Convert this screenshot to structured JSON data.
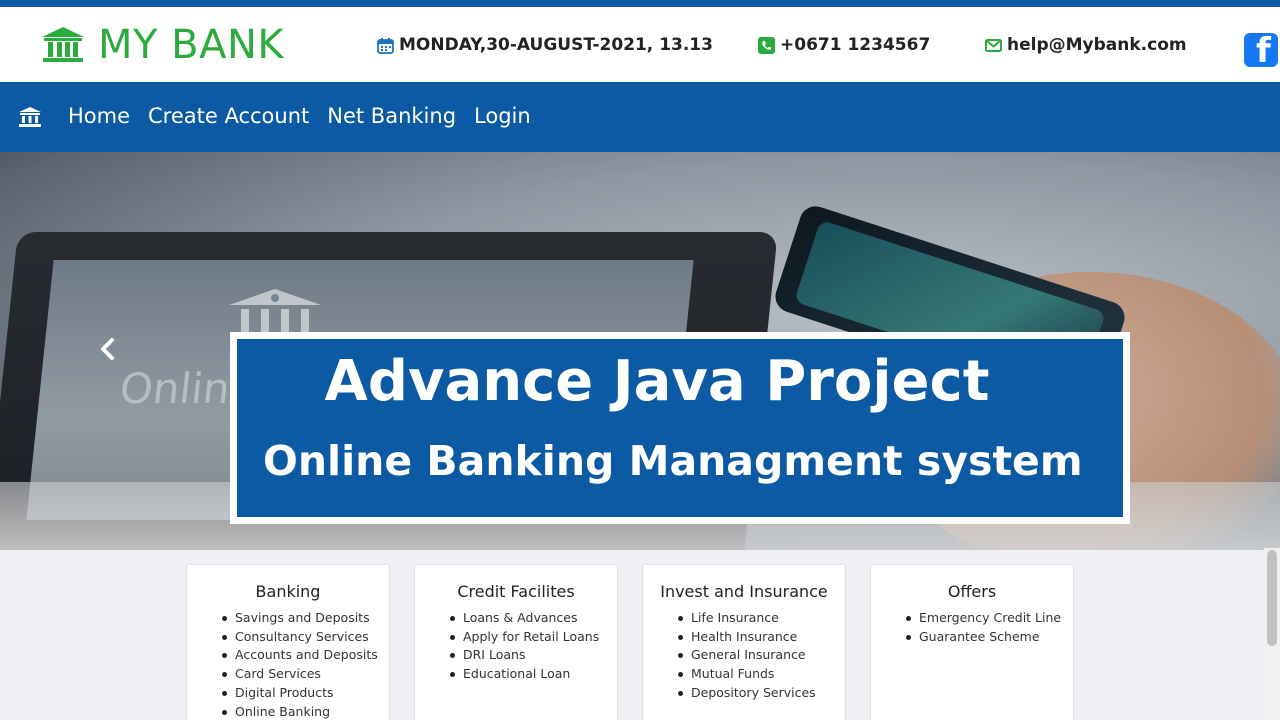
{
  "header": {
    "logo_text": "MY BANK",
    "date": "MONDAY,30-AUGUST-2021, 13.13",
    "phone": "+0671 1234567",
    "email": "help@Mybank.com",
    "icons": {
      "logo": "bank-building-icon",
      "date": "calendar-icon",
      "phone": "phone-icon",
      "email": "envelope-icon",
      "social": "facebook-icon"
    },
    "colors": {
      "brand": "#2bab3e",
      "accent": "#0b5aa3"
    }
  },
  "navbar": {
    "icon": "bank-building-icon",
    "links": [
      "Home",
      "Create Account",
      "Net Banking",
      "Login"
    ]
  },
  "hero": {
    "background_text": "Online Ba",
    "banner_title": "Advance Java Project",
    "banner_subtitle": "Online Banking Managment system",
    "prev_icon": "chevron-left-icon"
  },
  "cards": [
    {
      "title": "Banking",
      "items": [
        "Savings and Deposits",
        "Consultancy Services",
        "Accounts and Deposits",
        "Card Services",
        "Digital Products",
        "Online Banking"
      ]
    },
    {
      "title": "Credit Facilites",
      "items": [
        "Loans & Advances",
        "Apply for Retail Loans",
        "DRI Loans",
        "Educational Loan"
      ]
    },
    {
      "title": "Invest and Insurance",
      "items": [
        "Life Insurance",
        "Health Insurance",
        "General Insurance",
        "Mutual Funds",
        "Depository Services"
      ]
    },
    {
      "title": "Offers",
      "items": [
        "Emergency Credit Line",
        "Guarantee Scheme"
      ]
    }
  ]
}
